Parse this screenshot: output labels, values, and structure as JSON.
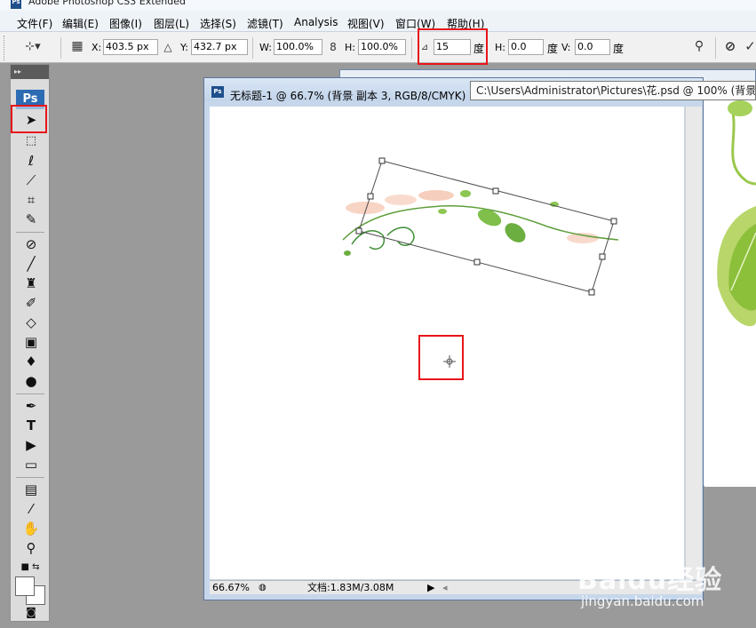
{
  "app": {
    "title": "Adobe Photoshop CS3 Extended",
    "icon": "Ps"
  },
  "menu": {
    "items": [
      "文件(F)",
      "编辑(E)",
      "图像(I)",
      "图层(L)",
      "选择(S)",
      "滤镜(T)",
      "Analysis",
      "视图(V)",
      "窗口(W)",
      "帮助(H)"
    ]
  },
  "options": {
    "x_label": "X:",
    "x_value": "403.5 px",
    "y_label": "Y:",
    "y_value": "432.7 px",
    "w_label": "W:",
    "w_value": "100.0%",
    "h_label": "H:",
    "h_value": "100.0%",
    "angle_value": "15",
    "angle_unit": "度",
    "hskew_label": "H:",
    "hskew_value": "0.0",
    "hskew_unit": "度",
    "vskew_label": "V:",
    "vskew_value": "0.0",
    "vskew_unit": "度"
  },
  "toolbox": {
    "logo": "Ps",
    "icons": [
      "move-tool-icon",
      "marquee-tool-icon",
      "lasso-tool-icon",
      "magic-wand-tool-icon",
      "crop-tool-icon",
      "slice-tool-icon",
      "healing-brush-tool-icon",
      "brush-tool-icon",
      "clone-stamp-tool-icon",
      "history-brush-tool-icon",
      "eraser-tool-icon",
      "gradient-tool-icon",
      "blur-tool-icon",
      "dodge-tool-icon",
      "pen-tool-icon",
      "type-tool-icon",
      "path-selection-tool-icon",
      "shape-tool-icon",
      "notes-tool-icon",
      "eyedropper-tool-icon",
      "hand-tool-icon",
      "zoom-tool-icon"
    ]
  },
  "document": {
    "title": "无标题-1 @ 66.7% (背景 副本 3, RGB/8/CMYK)",
    "zoom": "66.67%",
    "doc_size": "文档:1.83M/3.08M"
  },
  "tooltip": {
    "text": "C:\\Users\\Administrator\\Pictures\\花.psd @ 100% (背景"
  },
  "watermark": {
    "brand": "Baidu经验",
    "url": "jingyan.baidu.com"
  },
  "colors": {
    "highlight": "#e8141a",
    "ps_blue": "#2d6bb3"
  }
}
